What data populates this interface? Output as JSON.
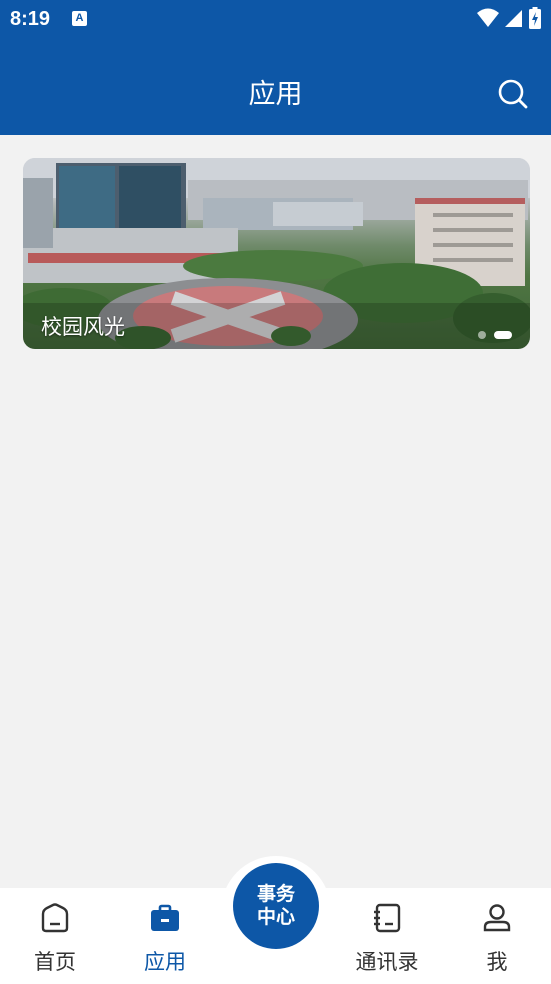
{
  "status_bar": {
    "time": "8:19",
    "notification_icon": "A"
  },
  "header": {
    "title": "应用",
    "search_icon": "search-icon"
  },
  "banner": {
    "caption": "校园风光",
    "dots_count": 2,
    "active_dot": 1
  },
  "tabs": [
    {
      "label": "首页",
      "icon": "home-icon",
      "active": false
    },
    {
      "label": "应用",
      "icon": "briefcase-icon",
      "active": true
    },
    {
      "label": "通讯录",
      "icon": "contacts-book-icon",
      "active": false
    },
    {
      "label": "我",
      "icon": "user-icon",
      "active": false
    }
  ],
  "center_button": {
    "line1": "事务",
    "line2": "中心"
  },
  "colors": {
    "primary": "#0d57a7",
    "background": "#f2f2f2",
    "tab_inactive": "#333333"
  }
}
